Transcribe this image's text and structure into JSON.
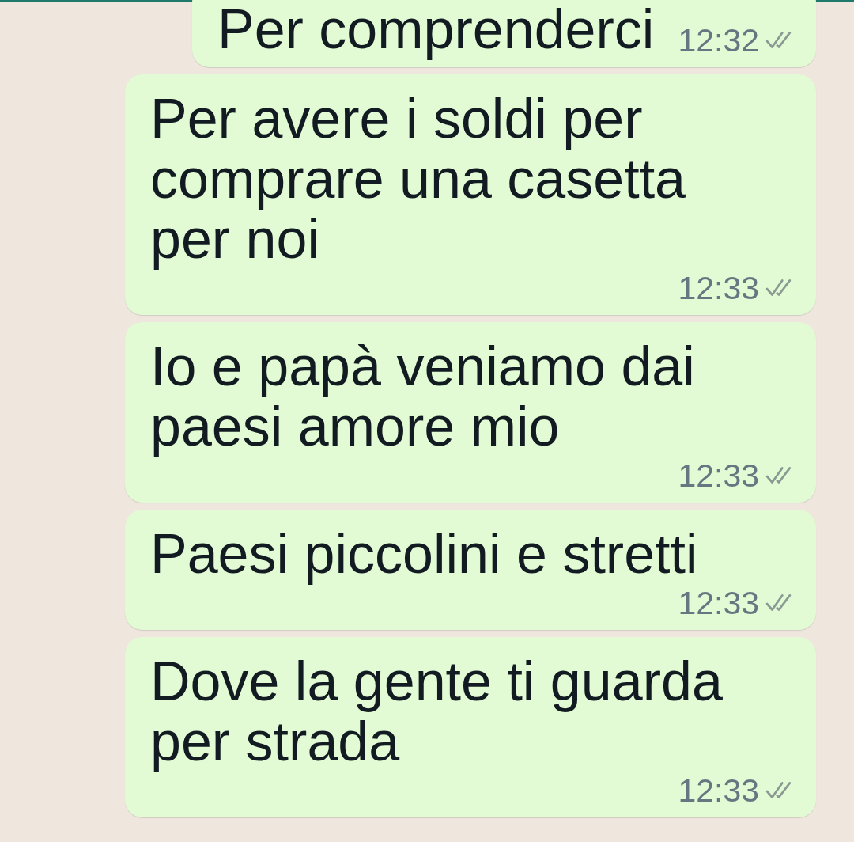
{
  "messages": [
    {
      "text": "Per comprenderci",
      "time": "12:32",
      "read": false
    },
    {
      "text": "Per avere i soldi per comprare una casetta per noi",
      "time": "12:33",
      "read": false
    },
    {
      "text": "Io e papà veniamo dai paesi amore mio",
      "time": "12:33",
      "read": false
    },
    {
      "text": "Paesi piccolini e stretti",
      "time": "12:33",
      "read": false
    },
    {
      "text": "Dove la gente ti guarda per strada",
      "time": "12:33",
      "read": false
    }
  ]
}
